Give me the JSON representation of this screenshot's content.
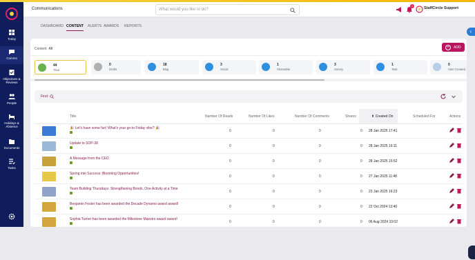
{
  "header": {
    "app_title": "Communications",
    "search_placeholder": "What would you like to do?",
    "company": "StaffCircle Support",
    "alert_badge": "5",
    "notif_badge": "1"
  },
  "sidebar": {
    "items": [
      {
        "label": "Today",
        "icon": "today-icon"
      },
      {
        "label": "Comms",
        "icon": "comms-icon"
      },
      {
        "label": "Objectives & Reviews",
        "icon": "objectives-icon"
      },
      {
        "label": "People",
        "icon": "people-icon"
      },
      {
        "label": "Holidays & Absence",
        "icon": "holidays-icon"
      },
      {
        "label": "Documents",
        "icon": "documents-icon"
      },
      {
        "label": "Tasks",
        "icon": "tasks-icon"
      }
    ]
  },
  "tabs": [
    "DASHBOARD",
    "CONTENT",
    "ALERTS",
    "AWARDS",
    "REPORTS"
  ],
  "content": {
    "label": "Content",
    "filter": "All",
    "add_label": "ADD"
  },
  "stats": [
    {
      "num": "44",
      "label": "Total",
      "color": "#6ab04c"
    },
    {
      "num": "0",
      "label": "Drafts",
      "color": "#b0b0b0"
    },
    {
      "num": "18",
      "label": "Blog",
      "color": "#2f8fe0"
    },
    {
      "num": "3",
      "label": "Social",
      "color": "#2f8fe0"
    },
    {
      "num": "1",
      "label": "Shareable",
      "color": "#2f8fe0"
    },
    {
      "num": "3",
      "label": "Survey",
      "color": "#2f8fe0"
    },
    {
      "num": "1",
      "label": "Task",
      "color": "#2f8fe0"
    },
    {
      "num": "0",
      "label": "User Created",
      "color": "#b7cde8"
    }
  ],
  "find": {
    "label": "Find:"
  },
  "table": {
    "headers": {
      "title": "Title",
      "reads": "Number Of Reads",
      "likes": "Number Of Likes",
      "comments": "Number Of Comments",
      "shares": "Shares",
      "created": "Created On",
      "scheduled": "Scheduled For",
      "actions": "Actions"
    },
    "rows": [
      {
        "title": "🎉 Let's have some fun! What's your go-to Friday vibe? 🎉",
        "reads": "0",
        "likes": "0",
        "comments": "0",
        "shares": "0",
        "created": "28 Jan 2025 17:41",
        "thumb": "#3a7bd5"
      },
      {
        "title": "Update to SOP-38",
        "reads": "0",
        "likes": "0",
        "comments": "0",
        "shares": "0",
        "created": "28 Jan 2025 16:11",
        "thumb": "#9bb8d6"
      },
      {
        "title": "A Message from the CEO",
        "reads": "0",
        "likes": "0",
        "comments": "0",
        "shares": "0",
        "created": "28 Jan 2025 15:52",
        "thumb": "#c9a23b"
      },
      {
        "title": "Spring into Success: Blooming Opportunities!",
        "reads": "0",
        "likes": "0",
        "comments": "0",
        "shares": "0",
        "created": "27 Jan 2025 11:48",
        "thumb": "#e8c84a"
      },
      {
        "title": "Team Building Thursdays: Strengthening Bonds, One Activity at a Time",
        "reads": "0",
        "likes": "0",
        "comments": "0",
        "shares": "0",
        "created": "23 Jan 2025 16:23",
        "thumb": "#8fa3c8"
      },
      {
        "title": "Benjamin Foster has been awarded the Decade Dynamo award award!",
        "reads": "0",
        "likes": "0",
        "comments": "0",
        "shares": "0",
        "created": "22 Oct 2024 13:40",
        "thumb": "#d4a640"
      },
      {
        "title": "Sophia Turner has been awarded the Milestone Maestro award award!",
        "reads": "0",
        "likes": "0",
        "comments": "0",
        "shares": "0",
        "created": "06 Aug 2024 10:02",
        "thumb": "#d4a640"
      }
    ]
  }
}
